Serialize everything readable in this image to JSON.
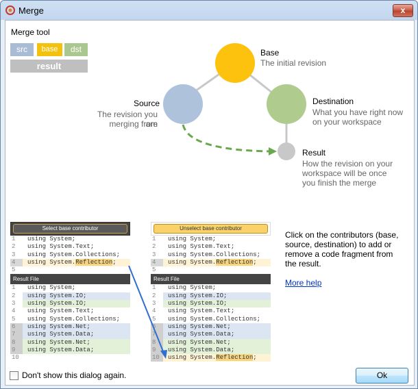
{
  "window": {
    "title": "Merge",
    "close_label": "x"
  },
  "legend": {
    "heading": "Merge tool",
    "src": "src",
    "base": "base",
    "dst": "dst",
    "result": "result"
  },
  "diagram": {
    "base": {
      "title": "Base",
      "desc": "The initial revision"
    },
    "source": {
      "title": "Source",
      "desc_line1": "The revision you are",
      "desc_line2": "merging from"
    },
    "destination": {
      "title": "Destination",
      "desc_line1": "What you have right now",
      "desc_line2": "on your workspace"
    },
    "result": {
      "title": "Result",
      "desc_line1": "How the revision on your",
      "desc_line2": "workspace will be once",
      "desc_line3": "you finish the merge"
    },
    "colors": {
      "base": "#fcc20d",
      "source": "#aec2dc",
      "destination": "#b0cb8e",
      "result": "#c8c8c8",
      "arrow": "#6aa84f",
      "edges": "#c8c8c8"
    }
  },
  "left_example": {
    "button": "Select base contributor",
    "code": [
      "using System;",
      "using System.Text;",
      "using System.Collections;",
      "using System.Reflection;",
      ""
    ],
    "line_numbers": [
      "1",
      "2",
      "3",
      "4",
      "5"
    ],
    "result_header": "Result File",
    "result_code": [
      "using System;",
      "using System.IO;",
      "using System.IO;",
      "using System.Text;",
      "using System.Collections;",
      "using System.Net;",
      "using System.Data;",
      "using System.Net;",
      "using System.Data;",
      ""
    ],
    "result_numbers": [
      "1",
      "2",
      "3",
      "4",
      "5",
      "6",
      "7",
      "8",
      "9",
      "10"
    ]
  },
  "right_example": {
    "button": "Unselect base contributor",
    "code": [
      "using System;",
      "using System.Text;",
      "using System.Collections;",
      "using System.Reflection;",
      ""
    ],
    "line_numbers": [
      "1",
      "2",
      "3",
      "4",
      "5"
    ],
    "result_header": "Result File",
    "result_code": [
      "using System;",
      "using System.IO;",
      "using System.IO;",
      "using System.Text;",
      "using System.Collections;",
      "using System.Net;",
      "using System.Data;",
      "using System.Net;",
      "using System.Data;",
      "using System.Reflection;"
    ],
    "result_numbers": [
      "1",
      "2",
      "3",
      "4",
      "5",
      "6",
      "7",
      "8",
      "9",
      "10"
    ]
  },
  "help": {
    "text": "Click on the contributors (base, source, destination) to add or remove a code fragment from the result.",
    "link": "More help"
  },
  "footer": {
    "checkbox_label": "Don't show this dialog again.",
    "ok": "Ok"
  }
}
